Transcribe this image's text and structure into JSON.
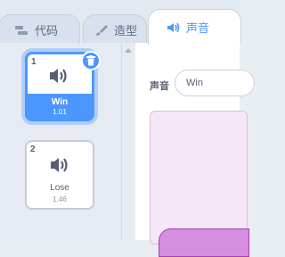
{
  "tabs": {
    "code_label": "代码",
    "costume_label": "造型",
    "sound_label": "声音"
  },
  "sounds": [
    {
      "number": "1",
      "name": "Win",
      "meta": "1.01"
    },
    {
      "number": "2",
      "name": "Lose",
      "meta": "1.46"
    }
  ],
  "editor": {
    "name_label": "声音",
    "name_value": "Win"
  },
  "colors": {
    "accent": "#4c97ff",
    "waveform_fill": "#d58ee0",
    "waveform_bg": "#f5e7f7"
  }
}
